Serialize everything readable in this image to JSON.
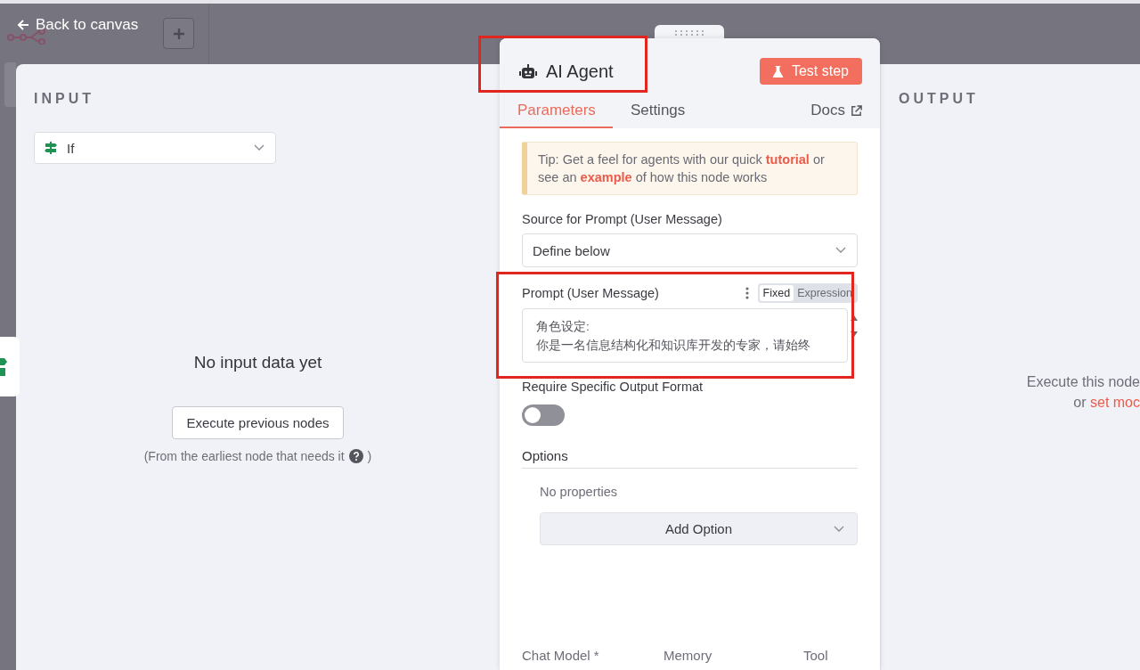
{
  "header": {
    "back_link": "Back to canvas"
  },
  "input_panel": {
    "heading": "INPUT",
    "node_select": {
      "value": "If"
    },
    "empty_title": "No input data yet",
    "button": "Execute previous nodes",
    "hint_before": "(From the earliest node that needs it",
    "hint_after": ")"
  },
  "output_panel": {
    "heading": "OUTPUT",
    "message": "Execute this node",
    "message_prefix": "or",
    "link": "set moc"
  },
  "node": {
    "title": "AI Agent",
    "test_button": "Test step",
    "tabs": [
      {
        "label": "Parameters",
        "selected": true
      },
      {
        "label": "Settings",
        "selected": false
      }
    ],
    "docs_link": "Docs",
    "tip": [
      {
        "kind": "text",
        "text": "Tip: Get a feel for agents with our quick"
      },
      {
        "kind": "link",
        "text": "tutorial"
      },
      {
        "kind": "text",
        "text": "or see an"
      },
      {
        "kind": "link",
        "text": "example"
      },
      {
        "kind": "text",
        "text": "of how this node works"
      }
    ],
    "prompt_source": {
      "label": "Source for Prompt (User Message)",
      "value": "Define below"
    },
    "prompt": {
      "label": "Prompt (User Message)",
      "modes": [
        {
          "label": "Fixed",
          "selected": true
        },
        {
          "label": "Expression",
          "selected": false
        }
      ],
      "value": "角色设定:\n你是一名信息结构化和知识库开发的专家，请始终"
    },
    "output_format": {
      "label": "Require Specific Output Format",
      "on": false
    },
    "options": {
      "heading": "Options",
      "empty": "No properties",
      "add_button": "Add Option"
    },
    "connections": [
      "Chat Model *",
      "Memory",
      "Tool"
    ]
  }
}
